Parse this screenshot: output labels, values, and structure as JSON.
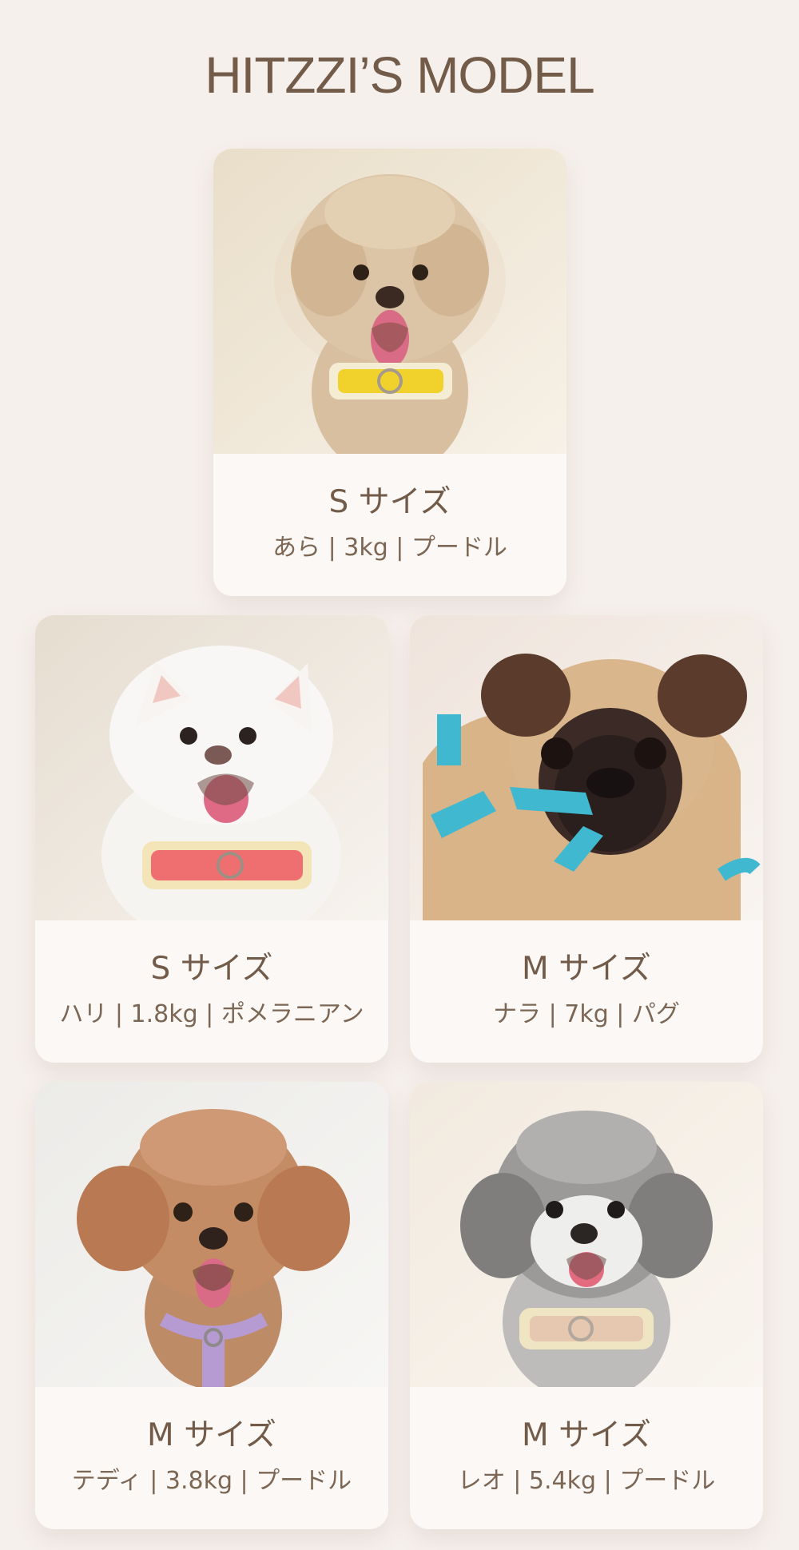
{
  "title": "HITZZI’S MODEL",
  "models": [
    {
      "size": "S サイズ",
      "info": "あら | 3kg | プードル"
    },
    {
      "size": "S サイズ",
      "info": "ハリ | 1.8kg | ポメラニアン"
    },
    {
      "size": "M サイズ",
      "info": "ナラ | 7kg | パグ"
    },
    {
      "size": "M サイズ",
      "info": "テディ | 3.8kg | プードル"
    },
    {
      "size": "M サイズ",
      "info": "レオ | 5.4kg | プードル"
    }
  ],
  "colors": {
    "background": "#f6f0ec",
    "card": "#fcf8f6",
    "text": "#725c49",
    "harness_yellow": "#f1d22d",
    "harness_pink": "#ef6f70",
    "harness_blue": "#3fb8d0",
    "harness_purple": "#b69ad2",
    "harness_cream": "#e8dcb3"
  },
  "icons": {
    "model_1": "apricot-poodle-photo",
    "model_2": "pomeranian-photo",
    "model_3": "pug-photo",
    "model_4": "red-poodle-photo",
    "model_5": "gray-poodle-photo"
  }
}
